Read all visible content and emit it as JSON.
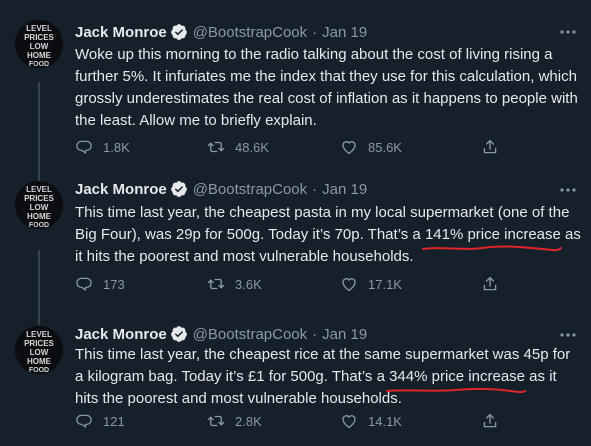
{
  "tweets": [
    {
      "author": "Jack Monroe",
      "handle": "@BootstrapCook",
      "separator": "·",
      "date": "Jan 19",
      "text": "Woke up this morning to the radio talking about the cost of living rising a further 5%. It infuriates me the index that they use for this calculation, which grossly underestimates the real cost of inflation as it happens to people with the least. Allow me to briefly explain.",
      "replies": "1.8K",
      "retweets": "48.6K",
      "likes": "85.6K"
    },
    {
      "author": "Jack Monroe",
      "handle": "@BootstrapCook",
      "separator": "·",
      "date": "Jan 19",
      "text_before": "This time last year, the cheapest pasta in my local supermarket (one of the Big Four), was 29p for 500g. Today it’s 70p. That’s a ",
      "text_highlight": "141% price increase",
      "text_after": " as it hits the poorest and most vulnerable households.",
      "replies": "173",
      "retweets": "3.6K",
      "likes": "17.1K"
    },
    {
      "author": "Jack Monroe",
      "handle": "@BootstrapCook",
      "separator": "·",
      "date": "Jan 19",
      "text_before": "This time last year, the cheapest rice at the same supermarket was 45p for a kilogram bag. Today it’s £1 for 500g. That’s a ",
      "text_highlight": "344% price increase",
      "text_after": " as it hits the poorest and most vulnerable households.",
      "replies": "121",
      "retweets": "2.8K",
      "likes": "14.1K"
    }
  ],
  "avatar_text": [
    "LEVEL",
    "PRICES",
    "LOW",
    "HOME",
    "FOOD"
  ],
  "colors": {
    "background": "#15202b",
    "text": "#e7e9ea",
    "secondary": "#8b98a5",
    "verified": "#1d9bf0",
    "thread_line": "#38444d",
    "annotation": "#e0262a"
  },
  "icons": [
    "verified-badge-icon",
    "more-options-icon",
    "reply-icon",
    "retweet-icon",
    "like-icon",
    "share-icon"
  ]
}
